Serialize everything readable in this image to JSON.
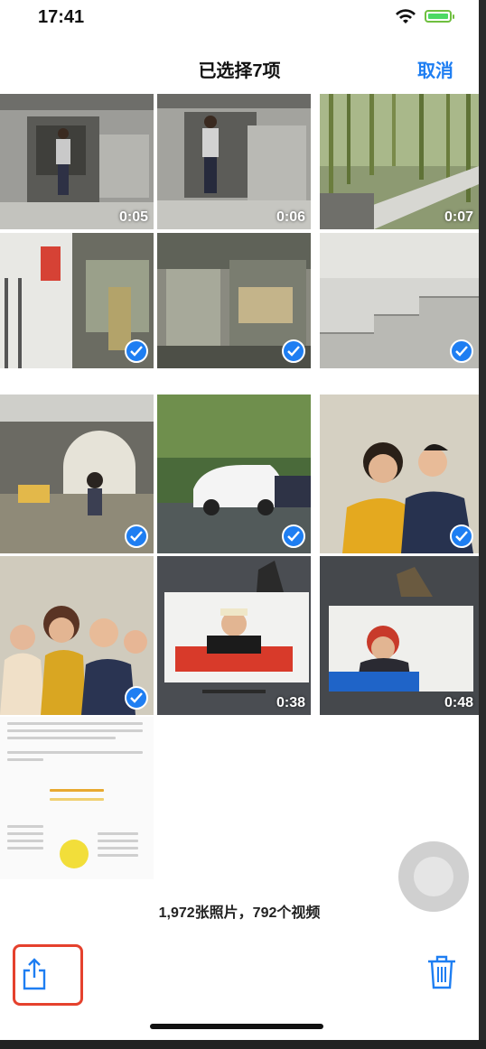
{
  "status_bar": {
    "time": "17:41"
  },
  "nav": {
    "title": "已选择7项",
    "cancel_label": "取消"
  },
  "grid": {
    "items": [
      {
        "label": "0:05",
        "selected": false
      },
      {
        "label": "0:06",
        "selected": false
      },
      {
        "label": "0:07",
        "selected": false
      },
      {
        "label": "",
        "selected": true
      },
      {
        "label": "",
        "selected": true
      },
      {
        "label": "",
        "selected": true
      },
      {
        "label": "",
        "selected": true
      },
      {
        "label": "",
        "selected": true
      },
      {
        "label": "",
        "selected": true
      },
      {
        "label": "",
        "selected": true
      },
      {
        "label": "0:38",
        "selected": false
      },
      {
        "label": "0:48",
        "selected": false
      }
    ]
  },
  "footer": {
    "count_text": "1,972张照片，792个视频"
  },
  "colors": {
    "accent": "#1e7ef2",
    "highlight": "#e5412d"
  },
  "toolbar": {
    "share_icon": "share-icon",
    "trash_icon": "trash-icon"
  }
}
